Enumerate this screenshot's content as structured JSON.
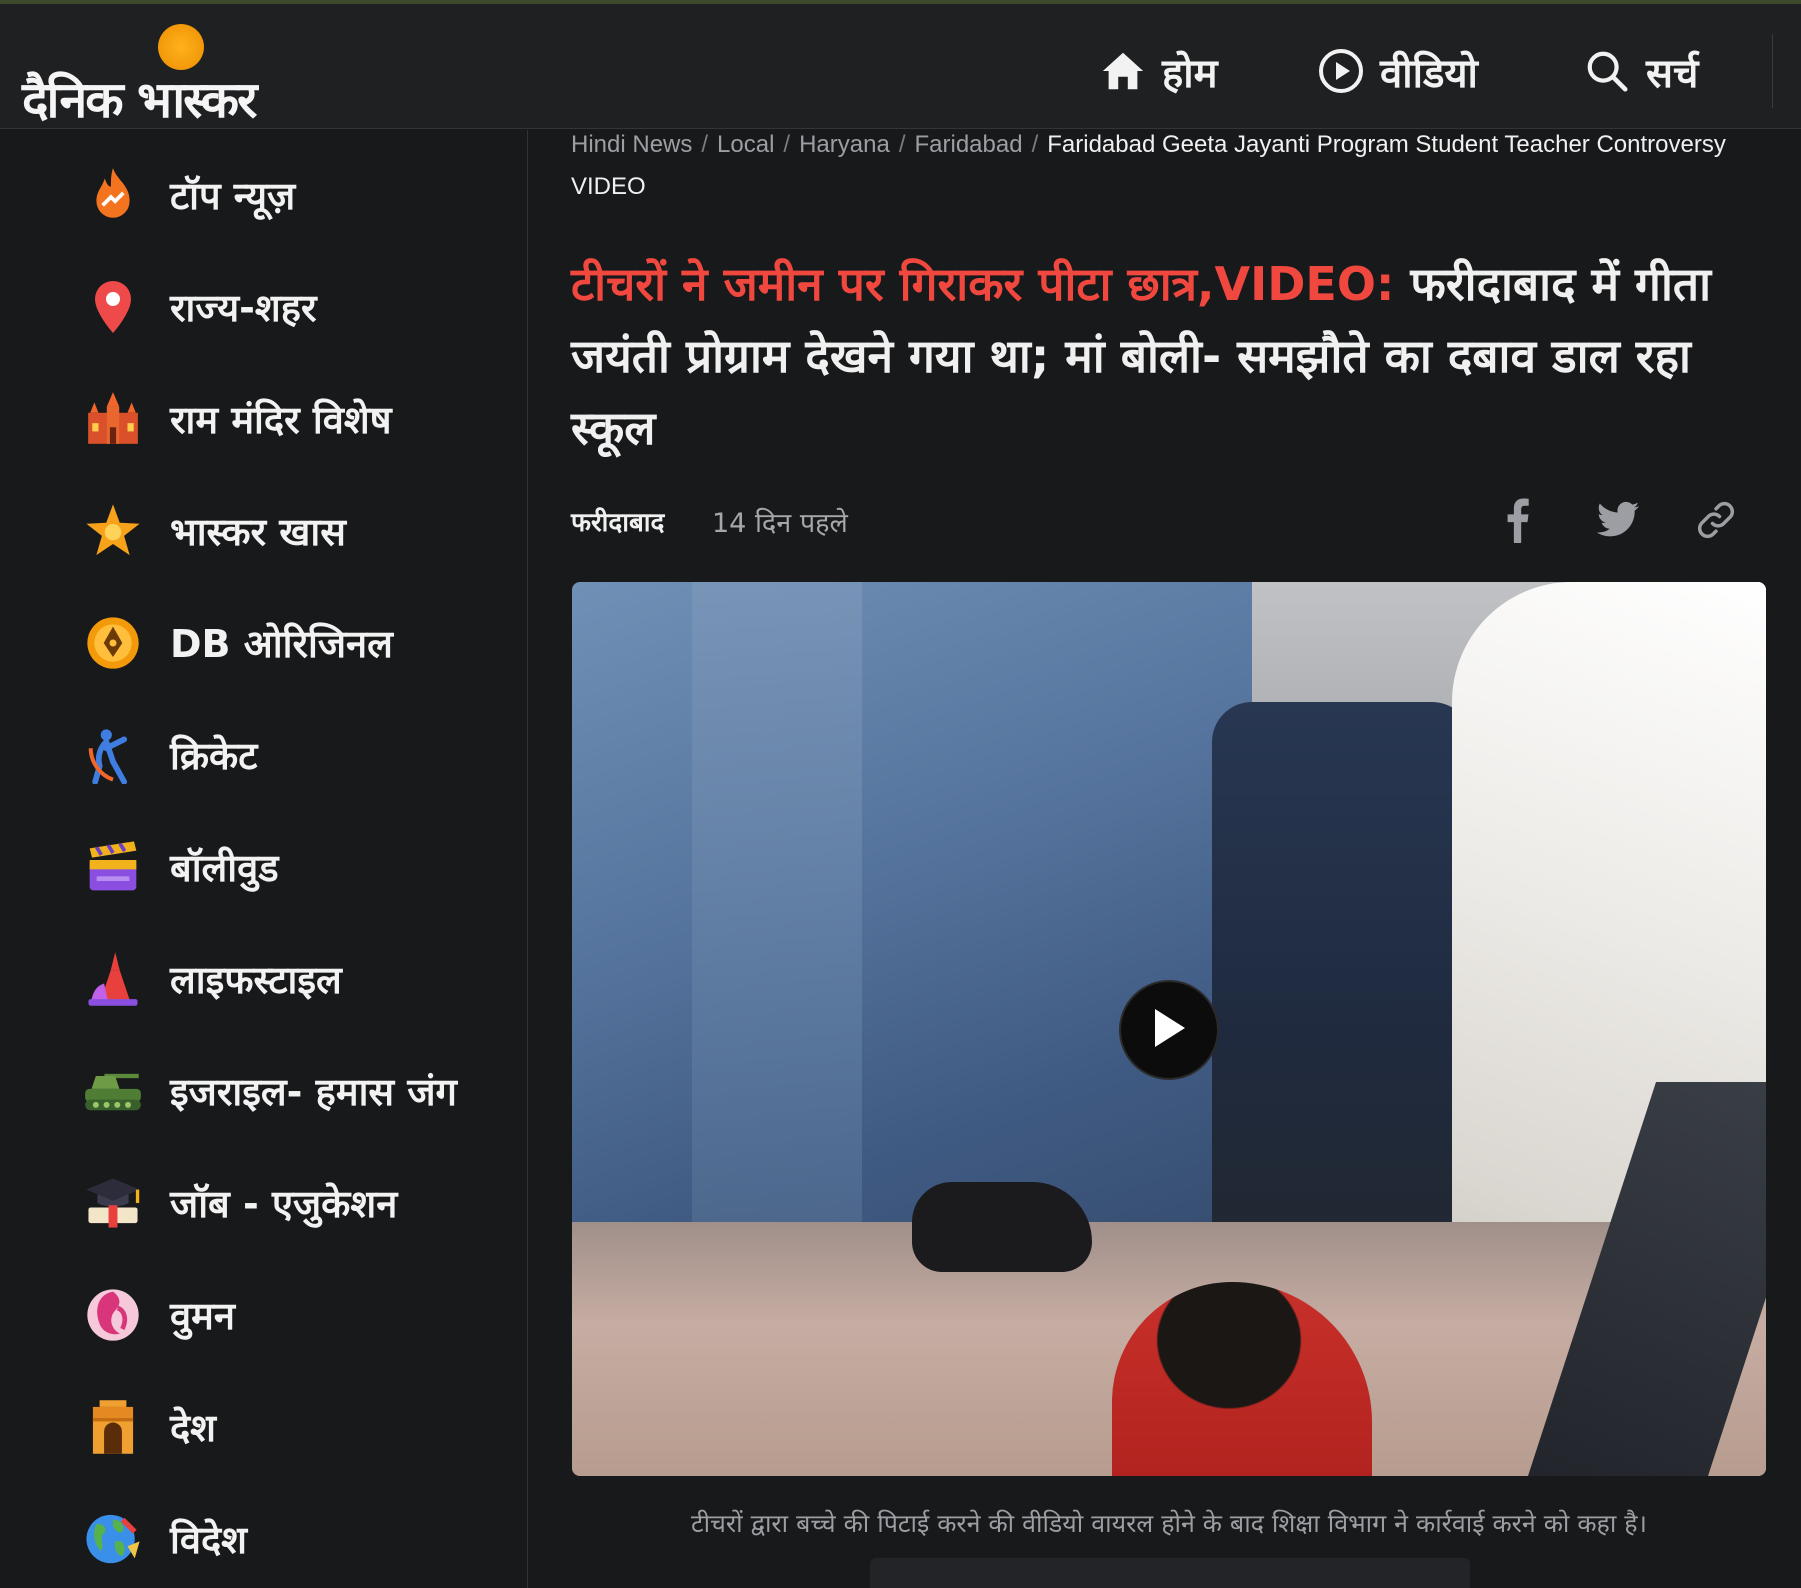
{
  "header": {
    "logo_text": "दैनिक भास्कर",
    "nav": [
      {
        "label": "होम",
        "icon": "home-icon"
      },
      {
        "label": "वीडियो",
        "icon": "play-circle-icon"
      },
      {
        "label": "सर्च",
        "icon": "search-icon"
      }
    ]
  },
  "sidebar": {
    "items": [
      {
        "label": "टॉप न्यूज़",
        "icon": "fire-icon"
      },
      {
        "label": "राज्य-शहर",
        "icon": "location-pin-icon"
      },
      {
        "label": "राम मंदिर विशेष",
        "icon": "temple-icon"
      },
      {
        "label": "भास्कर खास",
        "icon": "star-icon"
      },
      {
        "label": "DB ओरिजिनल",
        "icon": "pen-nib-icon"
      },
      {
        "label": "क्रिकेट",
        "icon": "cricket-player-icon"
      },
      {
        "label": "बॉलीवुड",
        "icon": "clapperboard-icon"
      },
      {
        "label": "लाइफस्टाइल",
        "icon": "dress-icon"
      },
      {
        "label": "इजराइल- हमास जंग",
        "icon": "tank-icon"
      },
      {
        "label": "जॉब - एजुकेशन",
        "icon": "graduation-cap-icon"
      },
      {
        "label": "वुमन",
        "icon": "woman-face-icon"
      },
      {
        "label": "देश",
        "icon": "india-gate-icon"
      },
      {
        "label": "विदेश",
        "icon": "globe-icon"
      }
    ]
  },
  "breadcrumb": {
    "items": [
      "Hindi News",
      "Local",
      "Haryana",
      "Faridabad"
    ],
    "current": "Faridabad Geeta Jayanti Program Student Teacher Controversy VIDEO"
  },
  "article": {
    "headline_red": "टीचरों ने जमीन पर गिराकर पीटा छात्र,VIDEO:",
    "headline_rest": " फरीदाबाद में गीता जयंती प्रोग्राम देखने गया था; मां बोली- समझौते का दबाव डाल रहा स्कूल",
    "place": "फरीदाबाद",
    "time": "14 दिन पहले",
    "share": [
      "facebook-icon",
      "twitter-icon",
      "link-icon"
    ],
    "caption": "टीचरों द्वारा बच्चे की पिटाई करने की वीडियो वायरल होने के बाद शिक्षा विभाग ने कार्रवाई करने को कहा है।"
  },
  "colors": {
    "background": "#18191b",
    "header": "#1f2022",
    "headline_accent": "#f0483f",
    "logo_sun": "#f39a0b"
  }
}
